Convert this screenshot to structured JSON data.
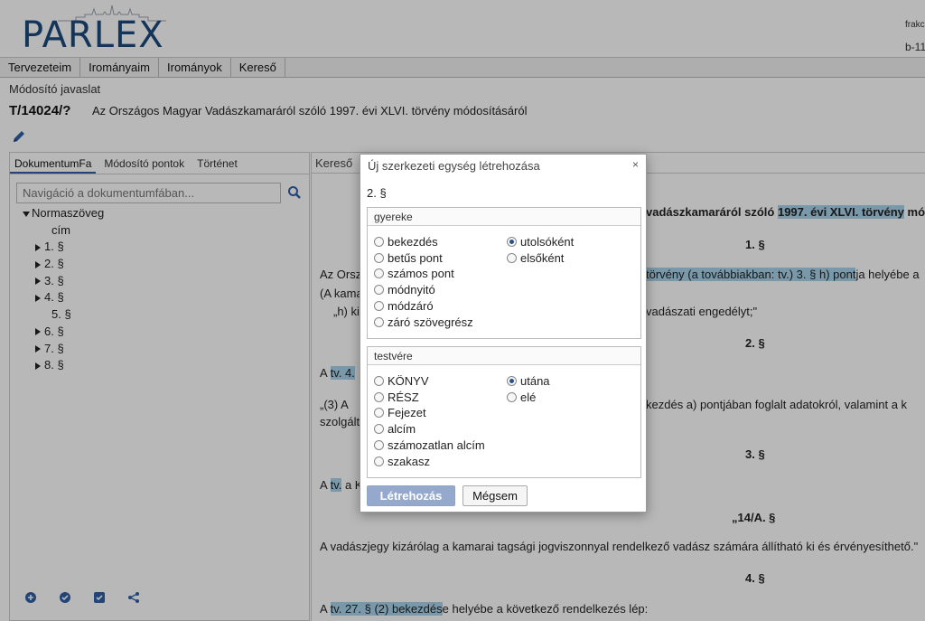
{
  "app": {
    "logo": "PARLEX",
    "user_line1": "frakc",
    "user_line2": "b-11"
  },
  "menu": [
    "Tervezeteim",
    "Irományaim",
    "Irományok",
    "Kereső"
  ],
  "doc": {
    "type": "Módosító javaslat",
    "id": "T/14024/?",
    "title": "Az Országos Magyar Vadászkamaráról szóló 1997. évi XLVI. törvény módosításáról"
  },
  "left_panel": {
    "tabs": [
      "DokumentumFa",
      "Módosító pontok",
      "Történet"
    ],
    "search_placeholder": "Navigáció a dokumentumfában...",
    "tree": {
      "root": "Normaszöveg",
      "cim": "cím",
      "items": [
        "1. §",
        "2. §",
        "3. §",
        "4. §",
        "5. §",
        "6. §",
        "7. §",
        "8. §"
      ]
    }
  },
  "right_panel": {
    "tab": "Kereső",
    "lines": {
      "head_pre": "vadászkamaráról szóló ",
      "head_hl": "1997. évi XLVI. törvény",
      "head_post": " mó",
      "s1": "1. §",
      "p1_pre": "Az Orsz",
      "p1_hl": "törvény (a továbbiakban: tv.) 3. § h) pont",
      "p1_post": "ja helyébe a",
      "p1b": "(A kama",
      "p1c_pre": "„h) ki",
      "p1c_post": "vadászati engedélyt;\"",
      "s2": "2. §",
      "p2_pre": "A ",
      "p2_hl": "tv. 4.",
      "p3_pre": "„(3) A",
      "p3_post": "kezdés a) pontjában foglalt adatokról, valamint a k",
      "p3b": "szolgált",
      "s3": "3. §",
      "p4_pre": "A ",
      "p4_hl": "tv.",
      "p4_post": " a K",
      "s14a": "„14/A. §",
      "p5": "A vadászjegy kizárólag a kamarai tagsági jogviszonnyal rendelkező vadász számára állítható ki és érvényesíthető.\"",
      "s4": "4. §",
      "p6_pre": "A ",
      "p6_hl": "tv. 27. § (2) bekezdés",
      "p6_post": "e helyébe a következő rendelkezés lép:"
    }
  },
  "modal": {
    "title": "Új szerkezeti egység létrehozása",
    "close": "×",
    "subtitle": "2. §",
    "child": {
      "legend": "gyereke",
      "types": [
        "bekezdés",
        "betűs pont",
        "számos pont",
        "módnyitó",
        "módzáró",
        "záró szövegrész"
      ],
      "positions": [
        "utolsóként",
        "elsőként"
      ],
      "selected_position": "utolsóként"
    },
    "sibling": {
      "legend": "testvére",
      "types": [
        "KÖNYV",
        "RÉSZ",
        "Fejezet",
        "alcím",
        "számozatlan alcím",
        "szakasz"
      ],
      "positions": [
        "utána",
        "elé"
      ],
      "selected_position": "utána"
    },
    "create_label": "Létrehozás",
    "cancel_label": "Mégsem"
  },
  "colors": {
    "accent": "#2f5fa8",
    "highlight": "#a8d3ea",
    "primary_button": "#95a9cc"
  }
}
